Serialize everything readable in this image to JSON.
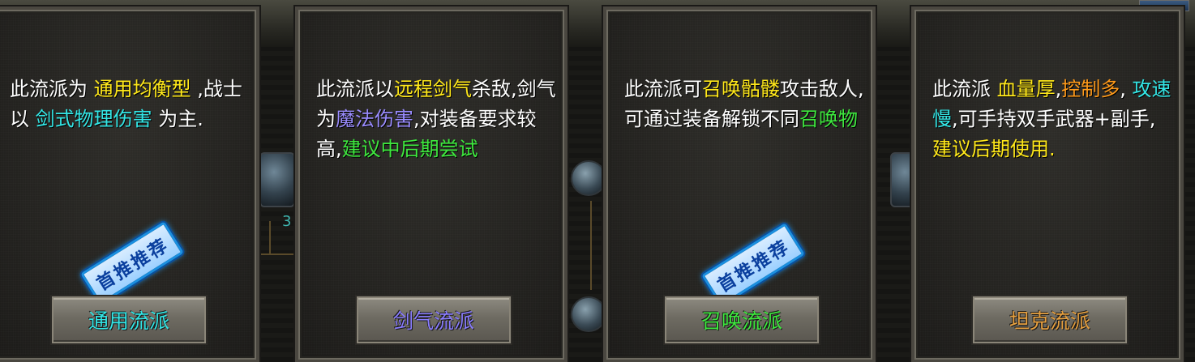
{
  "panels": [
    {
      "desc": [
        {
          "t": "此流派为 ",
          "c": "w"
        },
        {
          "t": "通用均衡型",
          "c": "yellow"
        },
        {
          "t": " ,战士以 ",
          "c": "w"
        },
        {
          "t": "剑式物理伤害",
          "c": "cyan"
        },
        {
          "t": " 为主.",
          "c": "w"
        }
      ],
      "button_label": "通用流派",
      "button_color": "#33e6e6",
      "stamp": "首推推荐"
    },
    {
      "desc": [
        {
          "t": "此流派以",
          "c": "w"
        },
        {
          "t": "远程剑气",
          "c": "yellow"
        },
        {
          "t": "杀敌,剑气为",
          "c": "w"
        },
        {
          "t": "魔法伤害",
          "c": "purple"
        },
        {
          "t": ",对装备要求较高,",
          "c": "w"
        },
        {
          "t": "建议中后期尝试",
          "c": "green"
        }
      ],
      "button_label": "剑气流派",
      "button_color": "#8a7dff",
      "stamp": ""
    },
    {
      "desc": [
        {
          "t": "此流派可",
          "c": "w"
        },
        {
          "t": "召唤骷髅",
          "c": "yellow"
        },
        {
          "t": "攻击敌人,可通过装备解锁不同",
          "c": "w"
        },
        {
          "t": "召唤物",
          "c": "green"
        }
      ],
      "button_label": "召唤流派",
      "button_color": "#3ee83e",
      "stamp": "首推推荐"
    },
    {
      "desc": [
        {
          "t": "此流派 ",
          "c": "w"
        },
        {
          "t": "血量厚",
          "c": "yellow"
        },
        {
          "t": ",",
          "c": "w"
        },
        {
          "t": "控制多",
          "c": "orange"
        },
        {
          "t": ", ",
          "c": "w"
        },
        {
          "t": "攻速慢",
          "c": "cyan"
        },
        {
          "t": ",可手持双手武器+副手,",
          "c": "w"
        },
        {
          "t": "建议后期使用.",
          "c": "yellow"
        }
      ],
      "button_label": "坦克流派",
      "button_color": "#e6a040",
      "stamp": ""
    }
  ],
  "background": {
    "numeral": "3"
  }
}
